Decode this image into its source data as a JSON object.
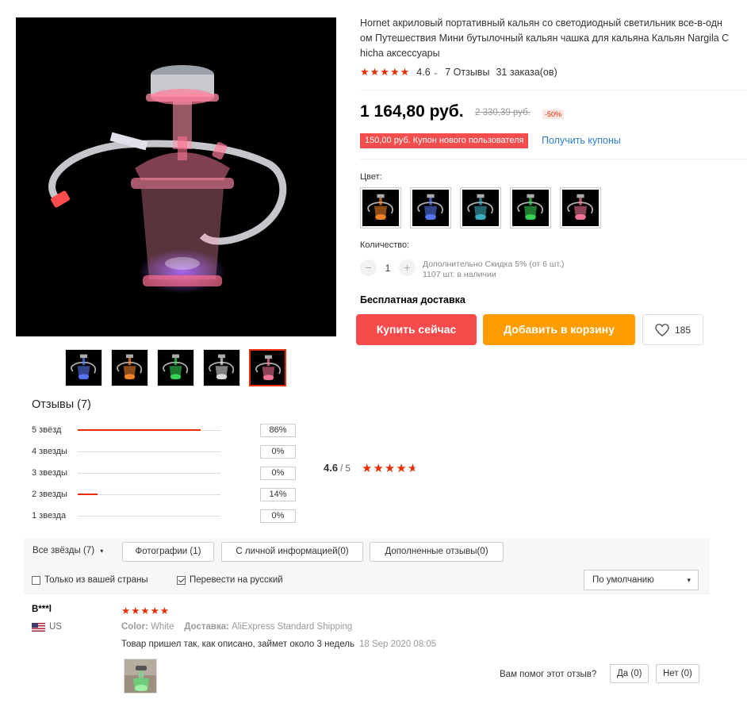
{
  "product": {
    "title_line1": "Hornet акриловый портативный кальян со светодиодный светильник все-в-одн",
    "title_line2": "ом Путешествия Мини бутылочный кальян чашка для кальяна Кальян Nargila C",
    "title_line3": "hicha аксессуары",
    "rating": "4.6",
    "reviews_link": "7 Отзывы",
    "orders": "31 заказа(ов)",
    "price": "1 164,80 руб.",
    "old_price": "2 330,39 руб.",
    "discount": "-50%",
    "coupon": "150,00 руб. Купон нового пользователя",
    "get_coupons": "Получить купоны",
    "color_label": "Цвет:",
    "color_options": [
      "orange",
      "blue",
      "blue-green",
      "green",
      "pink"
    ],
    "qty_label": "Количество:",
    "qty_minus": "−",
    "qty_plus": "+",
    "qty_value": "1",
    "qty_discount_note": "Дополнительно Скидка 5% (от 6 шт.)",
    "qty_stock": "1107 шт. в наличии",
    "free_shipping": "Бесплатная доставка",
    "buy_now": "Купить сейчас",
    "add_to_cart": "Добавить в корзину",
    "wishlist_count": "185",
    "thumbnails": [
      "blue",
      "orange",
      "green",
      "white",
      "pink"
    ],
    "active_thumbnail": 4
  },
  "reviews": {
    "title": "Отзывы (7)",
    "breakdown": [
      {
        "label": "5 звёзд",
        "pct": "86%",
        "fill": 0.86
      },
      {
        "label": "4 звезды",
        "pct": "0%",
        "fill": 0
      },
      {
        "label": "3 звезды",
        "pct": "0%",
        "fill": 0
      },
      {
        "label": "2 звезды",
        "pct": "14%",
        "fill": 0.14
      },
      {
        "label": "1 звезда",
        "pct": "0%",
        "fill": 0
      }
    ],
    "average": "4.6",
    "average_of": "/ 5",
    "filters": {
      "all_stars": "Все звёзды (7)",
      "photos": "Фотографии (1)",
      "personal_info": "С личной информацией(0)",
      "additional": "Дополненные отзывы(0)",
      "own_country": "Только из вашей страны",
      "translate": "Перевести на русский",
      "sort": "По умолчанию"
    },
    "items": [
      {
        "user": "B***l",
        "country": "US",
        "stars": "★★★★★",
        "color_label": "Color:",
        "color_value": "White",
        "shipping_label": "Доставка:",
        "shipping_value": "AliExpress Standard Shipping",
        "text": "Товар пришел так, как описано, займет около 3 недель",
        "date": "18 Sep 2020 08:05",
        "helpful_q": "Вам помог этот отзыв?",
        "yes": "Да (0)",
        "no": "Нет (0)"
      }
    ]
  },
  "colors": {
    "accent": "#e62e04",
    "buy_now": "#f74a4a",
    "add_cart": "#ff9c00",
    "link": "#2d7dd2"
  }
}
